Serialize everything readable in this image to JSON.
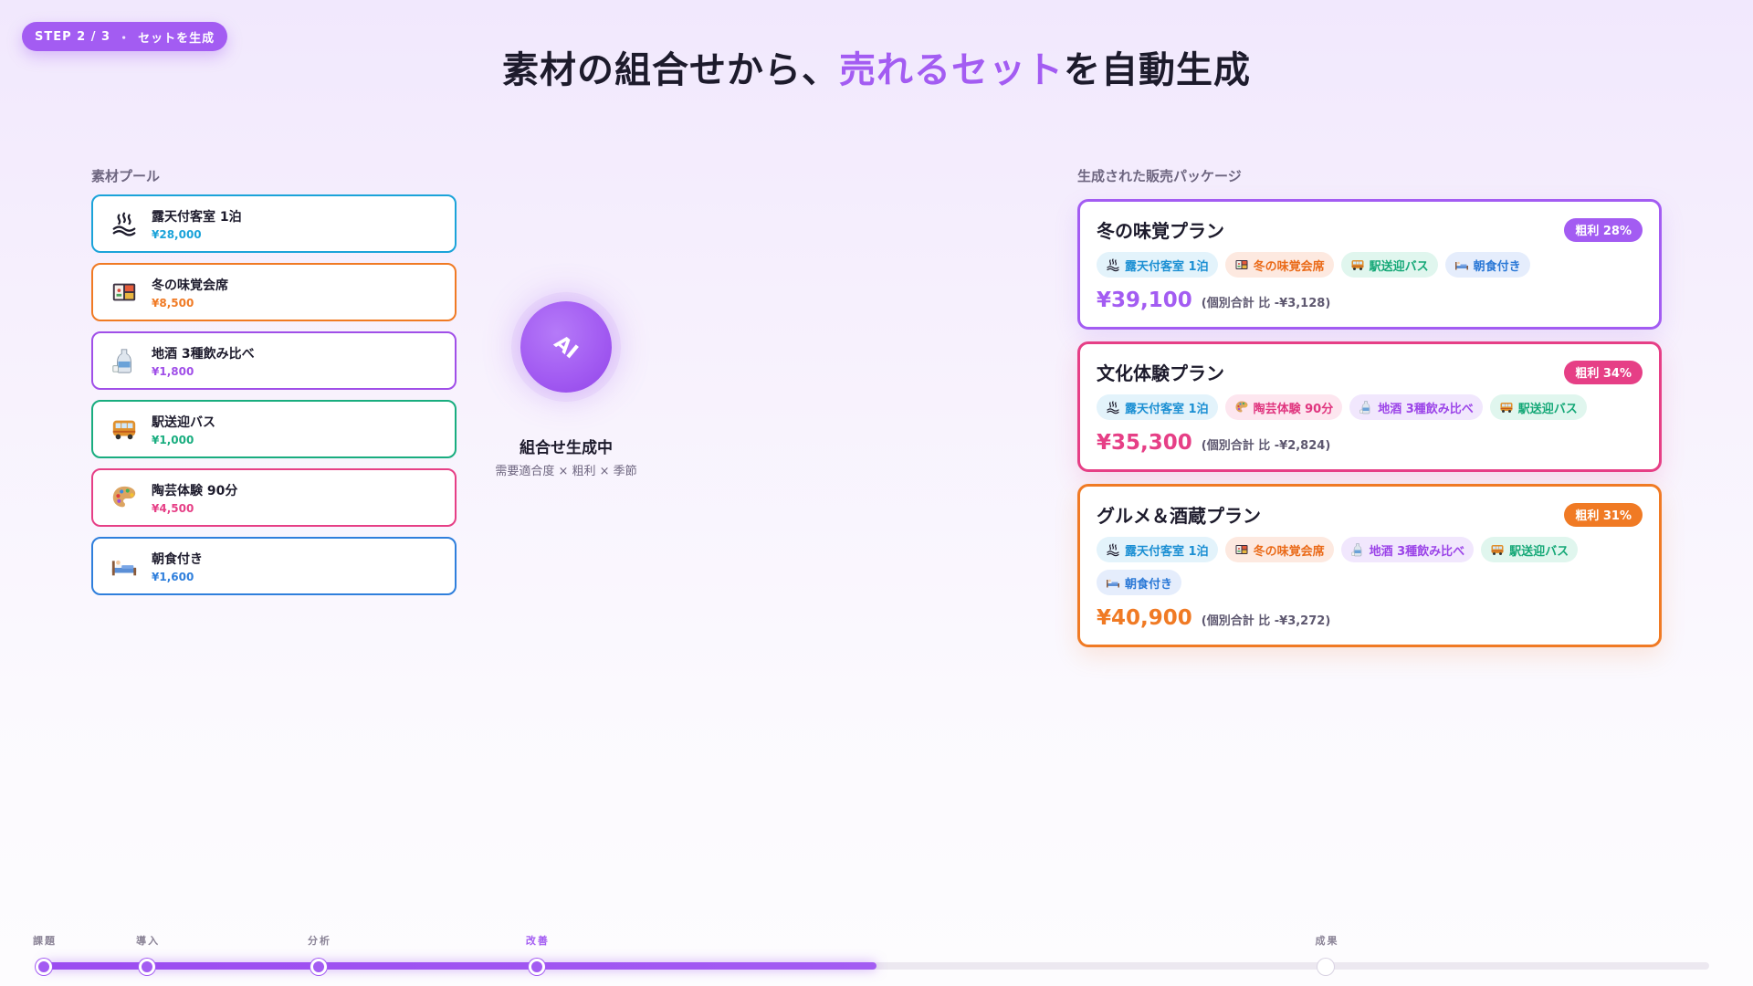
{
  "step_badge": {
    "step": "STEP 2 / 3",
    "separator": "・",
    "label": "セットを生成"
  },
  "title": {
    "before": "素材の組合せから、",
    "accent": "売れるセット",
    "after": "を自動生成"
  },
  "pool": {
    "label": "素材プール",
    "items": [
      {
        "name": "露天付客室 1泊",
        "price": "¥28,000",
        "color": "#1ba3d9",
        "icon": "hot-spring-icon"
      },
      {
        "name": "冬の味覚会席",
        "price": "¥8,500",
        "color": "#f07a24",
        "icon": "bento-icon"
      },
      {
        "name": "地酒 3種飲み比べ",
        "price": "¥1,800",
        "color": "#a04fe8",
        "icon": "sake-icon"
      },
      {
        "name": "駅送迎バス",
        "price": "¥1,000",
        "color": "#19ad7f",
        "icon": "bus-icon"
      },
      {
        "name": "陶芸体験 90分",
        "price": "¥4,500",
        "color": "#e63f86",
        "icon": "palette-icon"
      },
      {
        "name": "朝食付き",
        "price": "¥1,600",
        "color": "#2f7fdc",
        "icon": "bed-icon"
      }
    ]
  },
  "ai": {
    "label": "AI",
    "title": "組合せ生成中",
    "subtitle": "需要適合度 × 粗利 × 季節"
  },
  "packages": {
    "label": "生成された販売パッケージ",
    "items": [
      {
        "name": "冬の味覚プラン",
        "margin": "粗利 28%",
        "color": "#a35cf2",
        "tags": [
          {
            "label": "露天付客室 1泊",
            "style": "cyan",
            "icon": "hot-spring-icon"
          },
          {
            "label": "冬の味覚会席",
            "style": "orange",
            "icon": "bento-icon"
          },
          {
            "label": "駅送迎バス",
            "style": "green",
            "icon": "bus-icon"
          },
          {
            "label": "朝食付き",
            "style": "blue",
            "icon": "bed-icon"
          }
        ],
        "price": "¥39,100",
        "compare": "(個別合計 比 -¥3,128)"
      },
      {
        "name": "文化体験プラン",
        "margin": "粗利 34%",
        "color": "#e63f86",
        "tags": [
          {
            "label": "露天付客室 1泊",
            "style": "cyan",
            "icon": "hot-spring-icon"
          },
          {
            "label": "陶芸体験 90分",
            "style": "pink",
            "icon": "palette-icon"
          },
          {
            "label": "地酒 3種飲み比べ",
            "style": "purple",
            "icon": "sake-icon"
          },
          {
            "label": "駅送迎バス",
            "style": "green",
            "icon": "bus-icon"
          }
        ],
        "price": "¥35,300",
        "compare": "(個別合計 比 -¥2,824)"
      },
      {
        "name": "グルメ＆酒蔵プラン",
        "margin": "粗利 31%",
        "color": "#f07a24",
        "tags": [
          {
            "label": "露天付客室 1泊",
            "style": "cyan",
            "icon": "hot-spring-icon"
          },
          {
            "label": "冬の味覚会席",
            "style": "orange",
            "icon": "bento-icon"
          },
          {
            "label": "地酒 3種飲み比べ",
            "style": "purple",
            "icon": "sake-icon"
          },
          {
            "label": "駅送迎バス",
            "style": "green",
            "icon": "bus-icon"
          },
          {
            "label": "朝食付き",
            "style": "blue",
            "icon": "bed-icon"
          }
        ],
        "price": "¥40,900",
        "compare": "(個別合計 比 -¥3,272)"
      }
    ]
  },
  "progress": {
    "fraction": 0.5,
    "milestones": [
      {
        "label": "課題",
        "at": 0.0,
        "done": true
      },
      {
        "label": "導入",
        "at": 0.062,
        "done": true
      },
      {
        "label": "分析",
        "at": 0.165,
        "done": true
      },
      {
        "label": "改善",
        "at": 0.296,
        "done": true,
        "active": true
      },
      {
        "label": "成果",
        "at": 0.77,
        "done": false
      }
    ]
  }
}
